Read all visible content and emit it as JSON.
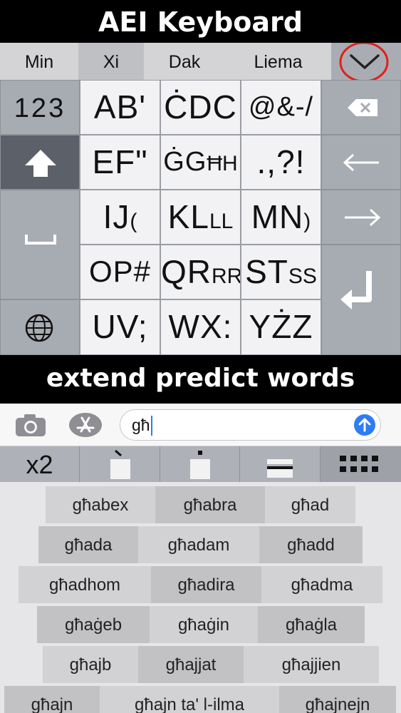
{
  "banners": {
    "top": "AEI Keyboard",
    "middle": "extend predict words"
  },
  "predictions": [
    "Min",
    "Xi",
    "Dak",
    "Liema"
  ],
  "collapse_icon": "chevron-down-icon",
  "annotation_color": "#e0201c",
  "keyboard": {
    "numbers_label": "123",
    "keys": [
      {
        "main": "AB",
        "extra": "ʹ"
      },
      {
        "main": "ĊDC",
        "extra": ""
      },
      {
        "main": "@&-/",
        "extra": ""
      },
      {
        "main": "EF",
        "extra": "\""
      },
      {
        "main": "ĠG",
        "extra": "ĦH"
      },
      {
        "main": ".,?!",
        "extra": ""
      },
      {
        "main": "IJ",
        "extra": "("
      },
      {
        "main": "KL",
        "extra": "LL"
      },
      {
        "main": "MN",
        "extra": ")"
      },
      {
        "main": "OP#",
        "extra": ""
      },
      {
        "main": "QR",
        "extra": "RR"
      },
      {
        "main": "ST",
        "extra": "SS"
      },
      {
        "main": "UV;",
        "extra": ""
      },
      {
        "main": "WX:",
        "extra": ""
      },
      {
        "main": "YŻZ",
        "extra": ""
      }
    ],
    "icons": {
      "shift": "shift-arrow-icon",
      "space": "space-bracket-icon",
      "globe": "globe-icon",
      "backspace": "backspace-icon",
      "left": "arrow-left-icon",
      "right": "arrow-right-icon",
      "return": "return-icon"
    }
  },
  "message_input": {
    "value": "għ",
    "camera_icon": "camera-icon",
    "appstore_icon": "app-store-icon",
    "send_icon": "send-arrow-icon",
    "accent_color": "#2f7cf6"
  },
  "accent_row": {
    "x2_label": "x2",
    "icons": [
      "grave-accent-key-icon",
      "dot-above-key-icon",
      "bar-key-icon",
      "grid-icon"
    ]
  },
  "words": [
    [
      "għabex",
      "għabra",
      "għad"
    ],
    [
      "għada",
      "għadam",
      "għadd"
    ],
    [
      "għadhom",
      "għadira",
      "għadma"
    ],
    [
      "għaġeb",
      "għaġin",
      "għaġla"
    ],
    [
      "għajb",
      "għajjat",
      "għajjien"
    ],
    [
      "għajn",
      "għajn ta' l-ilma",
      "għajnejn"
    ]
  ]
}
